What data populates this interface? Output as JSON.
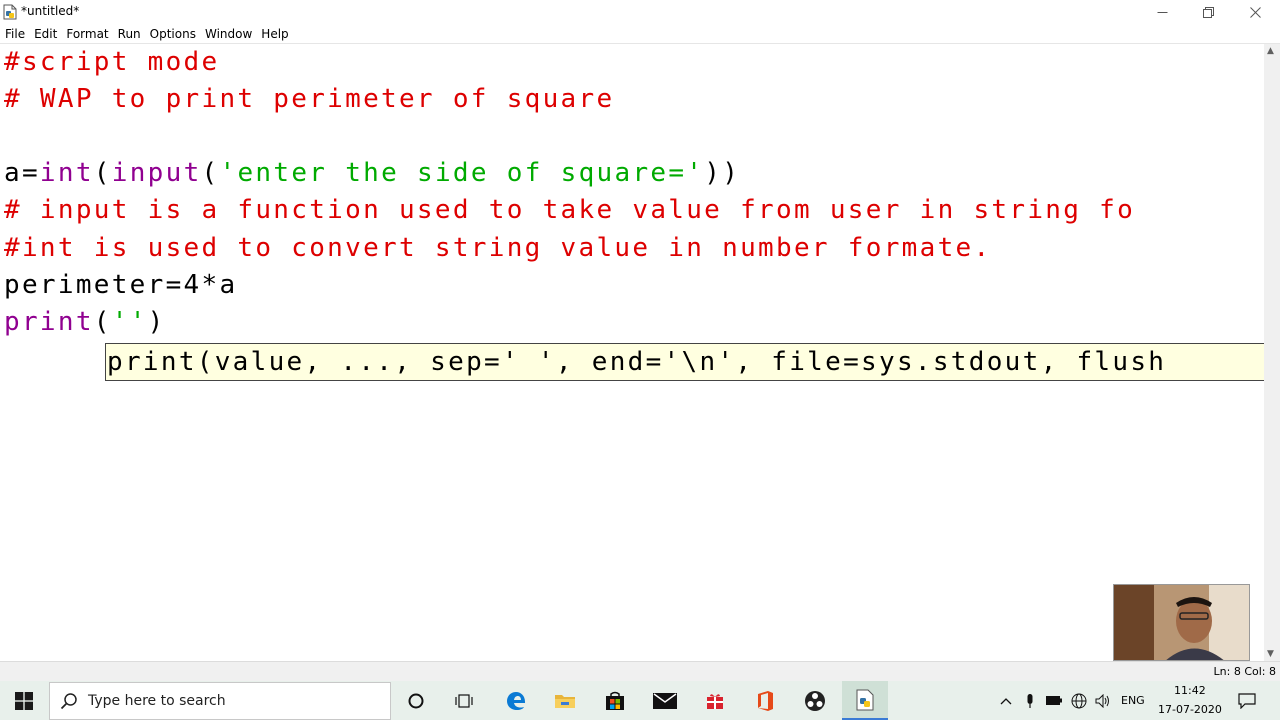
{
  "window": {
    "title": "*untitled*",
    "controls": {
      "minimize": "—",
      "maximize": "❐",
      "close": "✕"
    }
  },
  "menu": [
    "File",
    "Edit",
    "Format",
    "Run",
    "Options",
    "Window",
    "Help"
  ],
  "code_lines": [
    [
      {
        "t": "#script mode",
        "c": "comment"
      }
    ],
    [
      {
        "t": "# WAP to print perimeter of square",
        "c": "comment"
      }
    ],
    [],
    [
      {
        "t": "a=",
        "c": "default"
      },
      {
        "t": "int",
        "c": "builtin"
      },
      {
        "t": "(",
        "c": "default"
      },
      {
        "t": "input",
        "c": "builtin"
      },
      {
        "t": "(",
        "c": "default"
      },
      {
        "t": "'enter the side of square='",
        "c": "string"
      },
      {
        "t": "))",
        "c": "default"
      }
    ],
    [
      {
        "t": "# input is a function used to take value from user in string fo",
        "c": "comment"
      }
    ],
    [
      {
        "t": "#int is used to convert string value in number formate.",
        "c": "comment"
      }
    ],
    [
      {
        "t": "perimeter=4*a",
        "c": "default"
      }
    ],
    [
      {
        "t": "print",
        "c": "builtin"
      },
      {
        "t": "(",
        "c": "default"
      },
      {
        "t": "''",
        "c": "string"
      },
      {
        "t": ")",
        "c": "default"
      }
    ]
  ],
  "calltip": "print(value, ..., sep=' ', end='\\n', file=sys.stdout, flush",
  "status": {
    "position": "Ln: 8  Col: 8"
  },
  "taskbar": {
    "search_placeholder": "Type here to search",
    "language": "ENG",
    "time": "11:42",
    "date": "17-07-2020"
  },
  "colors": {
    "comment": "#dd0000",
    "builtin": "#900090",
    "string": "#00aa00",
    "calltip_bg": "#ffffe0",
    "taskbar_bg": "#e8f0eb"
  }
}
